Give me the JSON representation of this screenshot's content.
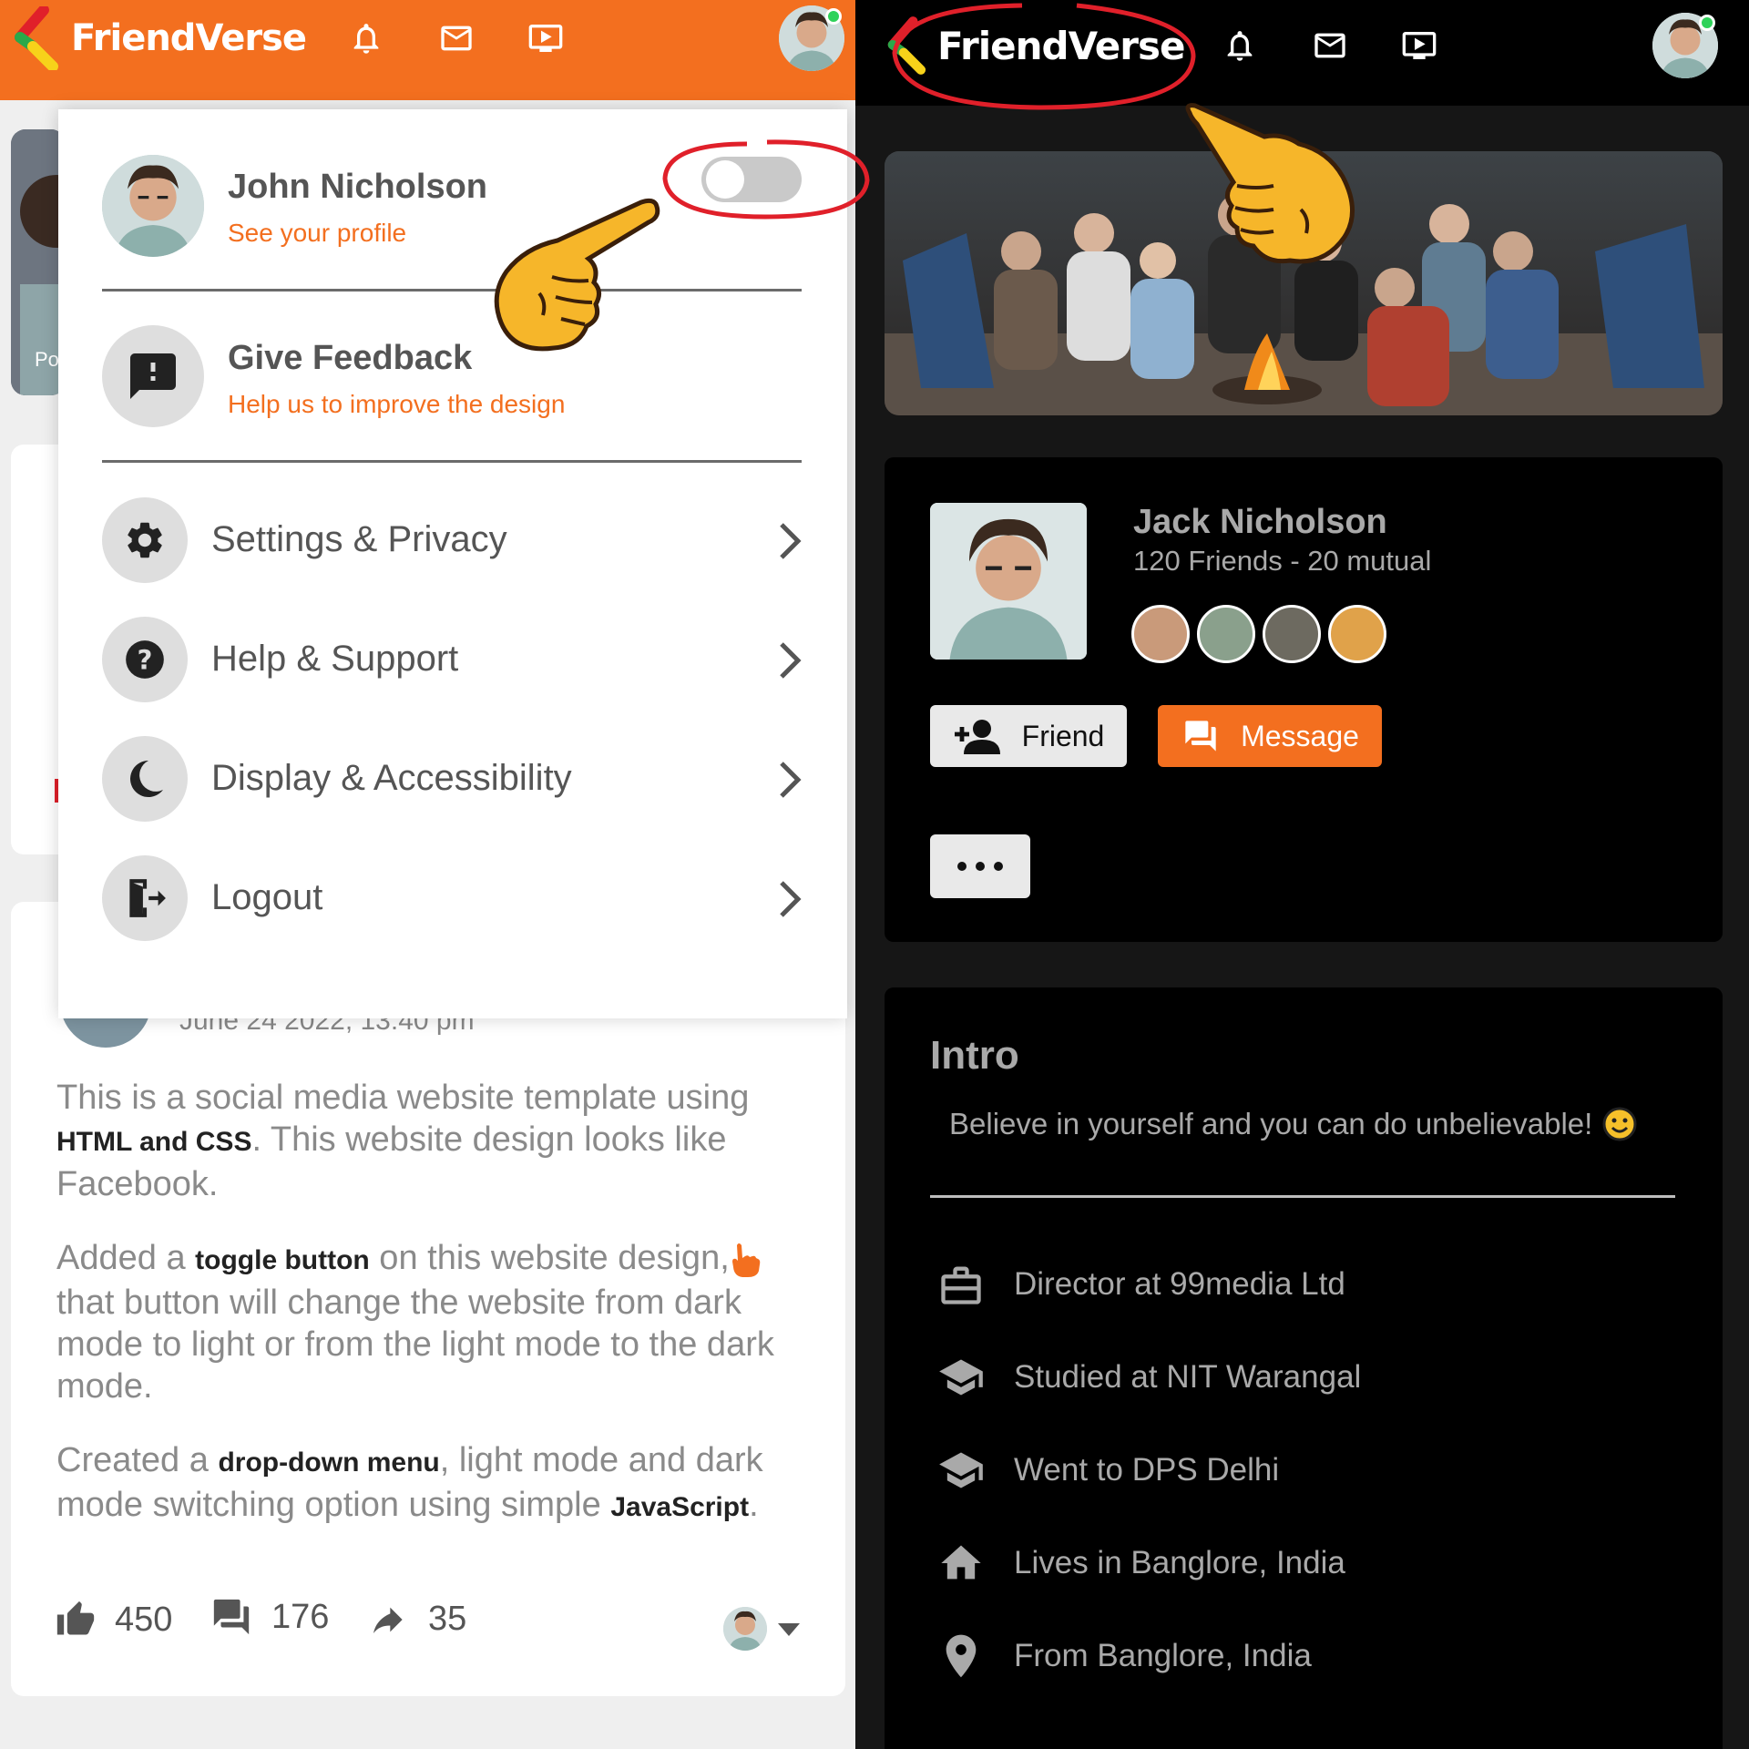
{
  "colors": {
    "brand_orange": "#f36f1f",
    "dark_bg": "#000000",
    "online_green": "#2fd25a",
    "annotation_red": "#e0202a",
    "pointer_yellow": "#f6b62a"
  },
  "left_panel": {
    "brand": "FriendVerse",
    "nav_icons": [
      "bell-icon",
      "mail-icon",
      "video-icon"
    ],
    "story_label": "Po",
    "dropdown": {
      "profile_name": "John Nicholson",
      "profile_link": "See your profile",
      "toggle_state": "off",
      "feedback_title": "Give Feedback",
      "feedback_sub": "Help us to improve the design",
      "menu_items": [
        {
          "label": "Settings & Privacy",
          "icon": "gear-icon"
        },
        {
          "label": "Help & Support",
          "icon": "help-icon"
        },
        {
          "label": "Display & Accessibility",
          "icon": "moon-icon"
        },
        {
          "label": "Logout",
          "icon": "logout-icon"
        }
      ]
    },
    "post": {
      "date": "June 24 2022, 13:40 pm",
      "p1_a": "This is a social media website template using ",
      "p1_b": "HTML and CSS",
      "p1_c": ". This website design looks like Facebook.",
      "p2_a": "Added a ",
      "p2_b": "toggle button",
      "p2_c": " on this website design,",
      "p2_d": " that button will change the website from dark mode to light or from the light mode to the dark mode.",
      "p3_a": "Created a ",
      "p3_b": "drop-down menu",
      "p3_c": ", light mode and dark mode switching option using simple ",
      "p3_d": "JavaScript",
      "p3_e": ".",
      "likes": "450",
      "comments": "176",
      "shares": "35"
    }
  },
  "right_panel": {
    "brand": "FriendVerse",
    "profile": {
      "name": "Jack Nicholson",
      "friends": "120 Friends - 20 mutual",
      "friend_button": "Friend",
      "message_button": "Message"
    },
    "intro": {
      "title": "Intro",
      "bio": "Believe in yourself and you can do unbelievable!",
      "rows": [
        {
          "icon": "briefcase-icon",
          "text": "Director at 99media Ltd"
        },
        {
          "icon": "graduation-cap-icon",
          "text": "Studied at NIT Warangal"
        },
        {
          "icon": "graduation-cap-icon",
          "text": "Went to DPS Delhi"
        },
        {
          "icon": "home-icon",
          "text": "Lives in Banglore, India"
        },
        {
          "icon": "location-pin-icon",
          "text": "From Banglore, India"
        }
      ]
    }
  }
}
